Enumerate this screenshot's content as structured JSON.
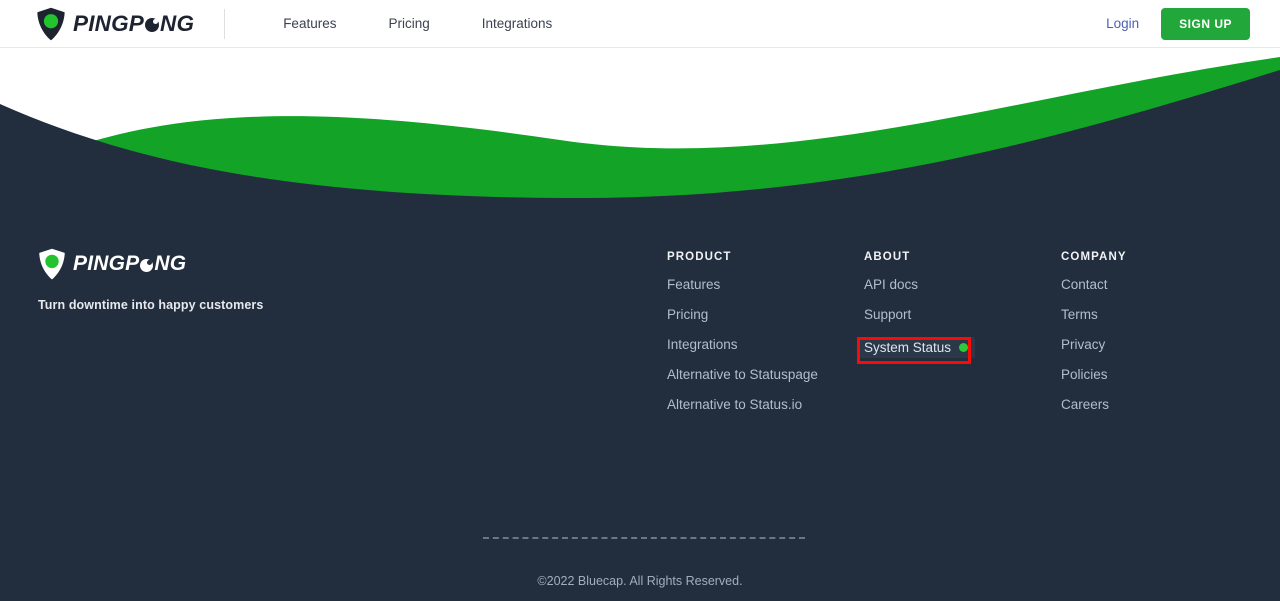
{
  "header": {
    "logo": {
      "brand_part1": "PINGP",
      "brand_part2": "NG",
      "icon": "shield-icon"
    },
    "nav": [
      {
        "label": "Features"
      },
      {
        "label": "Pricing"
      },
      {
        "label": "Integrations"
      }
    ],
    "login_label": "Login",
    "signup_label": "SIGN UP",
    "colors": {
      "accent_green": "#22a83a",
      "login_blue": "#4d5fb3",
      "text_dark": "#3b4250"
    }
  },
  "hero_wave": {
    "green": "#13a326",
    "navy": "#222d3d",
    "white": "#ffffff"
  },
  "footer": {
    "logo": {
      "brand_part1": "PINGP",
      "brand_part2": "NG",
      "icon": "shield-icon"
    },
    "tagline": "Turn downtime into happy customers",
    "columns": [
      {
        "title": "PRODUCT",
        "links": [
          {
            "label": "Features"
          },
          {
            "label": "Pricing"
          },
          {
            "label": "Integrations"
          },
          {
            "label": "Alternative to Statuspage"
          },
          {
            "label": "Alternative to Status.io"
          }
        ]
      },
      {
        "title": "ABOUT",
        "links": [
          {
            "label": "API docs"
          },
          {
            "label": "Support"
          },
          {
            "label": "System Status",
            "status_dot": true,
            "status_color": "#2dc938",
            "highlighted": true
          }
        ]
      },
      {
        "title": "COMPANY",
        "links": [
          {
            "label": "Contact"
          },
          {
            "label": "Terms"
          },
          {
            "label": "Privacy"
          },
          {
            "label": "Policies"
          },
          {
            "label": "Careers"
          }
        ]
      }
    ],
    "copyright": "©2022 Bluecap. All Rights Reserved.",
    "background": "#222d3d"
  },
  "annotation": {
    "target": "System Status",
    "color": "#fb0b08"
  }
}
